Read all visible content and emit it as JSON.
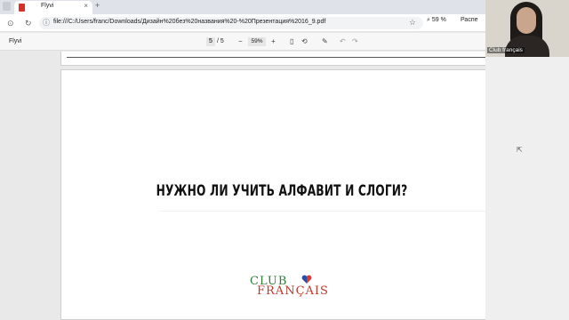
{
  "browser": {
    "tab_title": "Flyvi",
    "tab_close": "×",
    "new_tab": "+",
    "url": "file:///C:/Users/franc/Downloads/Дизайн%20без%20названия%20-%20Презентация%2016_9.pdf",
    "zoom_badge": "59 %",
    "share_label": "Распе"
  },
  "pdf_toolbar": {
    "title": "Flyvi",
    "current_page": "5",
    "page_separator": "/ 5",
    "zoom_out": "−",
    "zoom_value": "59%",
    "zoom_in": "+"
  },
  "slide": {
    "heading": "НУЖНО ЛИ УЧИТЬ АЛФАВИТ И СЛОГИ?",
    "logo_top": "CLUB",
    "logo_bottom": "FRANÇAIS"
  },
  "webcam": {
    "label": "Club français"
  },
  "icons": {
    "back": "back-arrow-icon",
    "reload": "reload-icon",
    "info": "file-info-icon",
    "star": "star-icon",
    "zoom": "zoom-icon",
    "fit": "fit-page-icon",
    "rotate": "rotate-icon",
    "draw": "draw-icon",
    "undo": "undo-icon",
    "redo": "redo-icon"
  },
  "colors": {
    "logo_green": "#2e7d3a",
    "logo_red": "#c0392b",
    "pdf_favicon": "#d93025"
  }
}
